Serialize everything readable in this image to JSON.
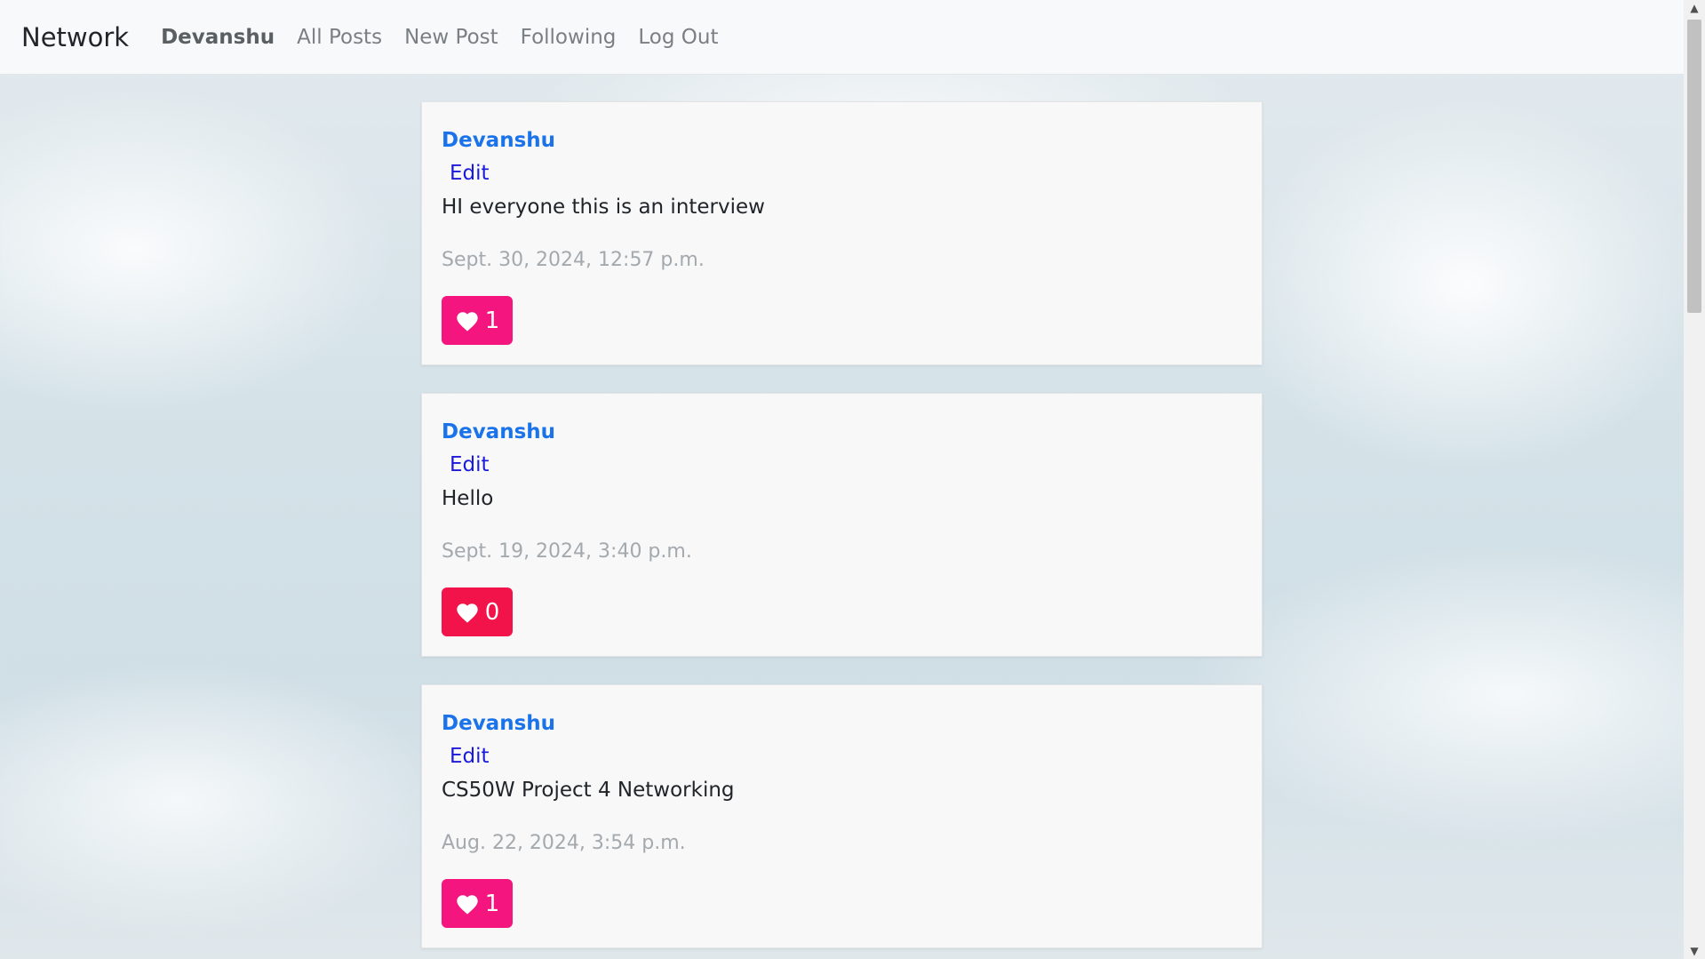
{
  "navbar": {
    "brand": "Network",
    "user": "Devanshu",
    "links": [
      "All Posts",
      "New Post",
      "Following",
      "Log Out"
    ]
  },
  "posts": [
    {
      "author": "Devanshu",
      "edit_label": "Edit",
      "content": "HI everyone this is an interview",
      "timestamp": "Sept. 30, 2024, 12:57 p.m.",
      "likes": "1",
      "like_color": "#f4157e"
    },
    {
      "author": "Devanshu",
      "edit_label": "Edit",
      "content": "Hello",
      "timestamp": "Sept. 19, 2024, 3:40 p.m.",
      "likes": "0",
      "like_color": "#f2134a"
    },
    {
      "author": "Devanshu",
      "edit_label": "Edit",
      "content": "CS50W Project 4 Networking",
      "timestamp": "Aug. 22, 2024, 3:54 p.m.",
      "likes": "1",
      "like_color": "#f4157e"
    }
  ],
  "icons": {
    "like": "heart-icon",
    "scroll_up": "chevron-up-icon",
    "scroll_down": "chevron-down-icon"
  },
  "colors": {
    "author_link": "#1a73e8",
    "edit_link": "#1a1ad8",
    "timestamp": "#a4a9ad"
  }
}
